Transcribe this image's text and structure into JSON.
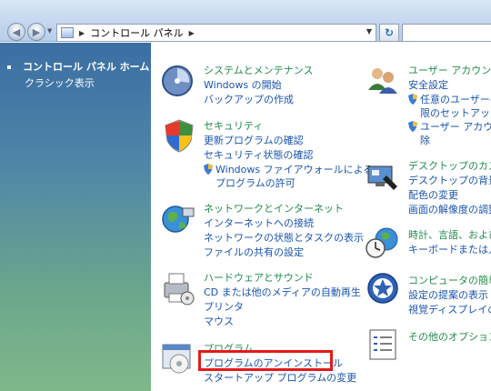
{
  "address": {
    "crumb": "コントロール パネル"
  },
  "left_pane": {
    "home": "コントロール パネル ホーム",
    "classic": "クラシック表示"
  },
  "categories_left": [
    {
      "title": "システムとメンテナンス",
      "links": [
        "Windows の開始",
        "バックアップの作成"
      ]
    },
    {
      "title": "セキュリティ",
      "links": [
        "更新プログラムの確認",
        "セキュリティ状態の確認"
      ],
      "shield_link": [
        "Windows ファイアウォールによる",
        "プログラムの許可"
      ]
    },
    {
      "title": "ネットワークとインターネット",
      "links": [
        "インターネットへの接続",
        "ネットワークの状態とタスクの表示",
        "ファイルの共有の設定"
      ]
    },
    {
      "title": "ハードウェアとサウンド",
      "links": [
        "CD または他のメディアの自動再生",
        "プリンタ",
        "マウス"
      ]
    },
    {
      "title": "プログラム",
      "links": [
        "プログラムのアンインストール",
        "スタートアップ プログラムの変更"
      ]
    }
  ],
  "categories_right": [
    {
      "title": "ユーザー アカウント",
      "links": [
        "安全設定"
      ],
      "shield1": [
        "任意のユーザーへ",
        "限のセットアップ"
      ],
      "shield2": [
        "ユーザー アカウン",
        "除"
      ]
    },
    {
      "title": "デスクトップのカスタ",
      "links": [
        "デスクトップの背景の",
        "配色の変更",
        "画面の解像度の調整"
      ]
    },
    {
      "title": "時計、言語、および地",
      "links": [
        "キーボードまたは入力"
      ]
    },
    {
      "title": "コンピュータの簡単操",
      "links": [
        "設定の提案の表示",
        "視覚ディスプレイの最"
      ]
    },
    {
      "title": "その他のオプション",
      "links": []
    }
  ],
  "colors": {
    "category_title": "#228b4c",
    "link": "#1a55b0",
    "highlight": "#e21a1a"
  }
}
